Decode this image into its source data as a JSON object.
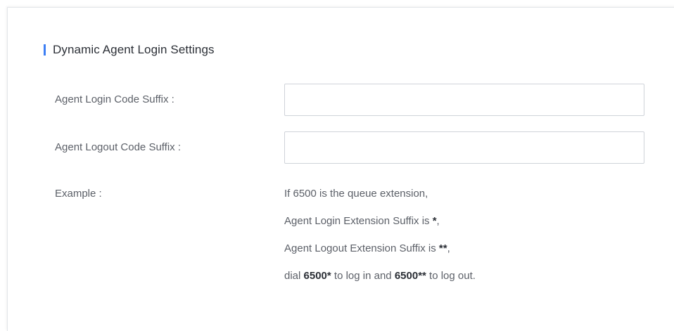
{
  "section": {
    "title": "Dynamic Agent Login Settings"
  },
  "form": {
    "login_suffix": {
      "label": "Agent Login Code Suffix :",
      "value": ""
    },
    "logout_suffix": {
      "label": "Agent Logout Code Suffix :",
      "value": ""
    },
    "example": {
      "label": "Example :",
      "line1": "If 6500 is the queue extension,",
      "line2_prefix": "Agent Login Extension Suffix is ",
      "line2_bold": "*",
      "line2_suffix": ",",
      "line3_prefix": "Agent Logout Extension Suffix is ",
      "line3_bold": "**",
      "line3_suffix": ",",
      "line4_prefix": "dial ",
      "line4_bold1": "6500*",
      "line4_mid": " to log in and ",
      "line4_bold2": "6500**",
      "line4_suffix": " to log out."
    }
  },
  "colors": {
    "accent": "#3d7ff4",
    "label_text": "#5c6068",
    "title_text": "#2b2f36",
    "field_border": "#cfd3d9"
  }
}
